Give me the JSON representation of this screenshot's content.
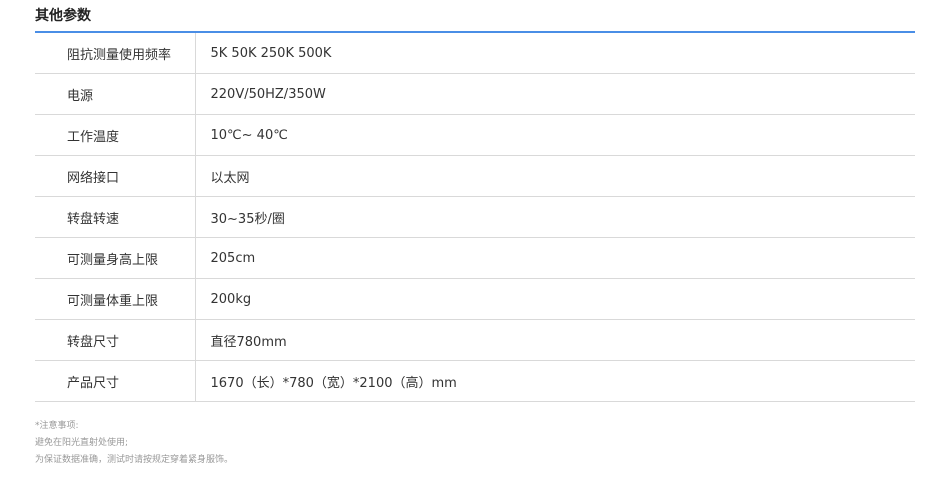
{
  "section": {
    "title": "其他参数"
  },
  "specs": [
    {
      "label": "阻抗测量使用频率",
      "value": "5K 50K 250K 500K"
    },
    {
      "label": "电源",
      "value": "220V/50HZ/350W"
    },
    {
      "label": "工作温度",
      "value": "10℃~ 40℃"
    },
    {
      "label": "网络接口",
      "value": "以太网"
    },
    {
      "label": "转盘转速",
      "value": "30~35秒/圈"
    },
    {
      "label": "可测量身高上限",
      "value": "205cm"
    },
    {
      "label": "可测量体重上限",
      "value": "200kg"
    },
    {
      "label": "转盘尺寸",
      "value": "直径780mm"
    },
    {
      "label": "产品尺寸",
      "value": "1670（长）*780（宽）*2100（高）mm"
    }
  ],
  "notes": {
    "heading": "*注意事项:",
    "lines": [
      "避免在阳光直射处使用;",
      "为保证数据准确，测试时请按规定穿着紧身服饰。"
    ]
  },
  "colors": {
    "accent": "#4a8ee6",
    "border": "#d9d9d9",
    "note_text": "#999999"
  }
}
